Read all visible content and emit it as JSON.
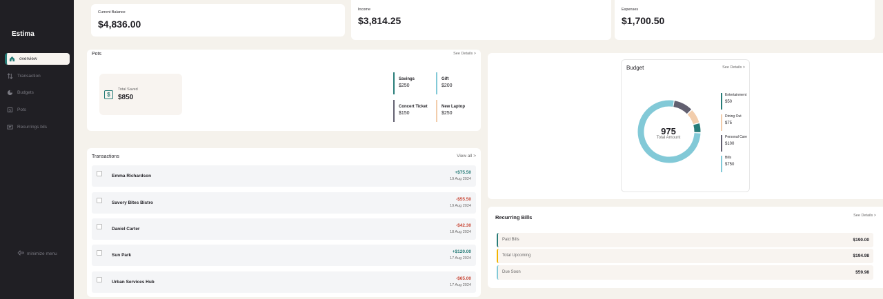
{
  "sidebar": {
    "brand": "Estima",
    "items": [
      {
        "label": "overview",
        "icon": "home-icon"
      },
      {
        "label": "Transaction",
        "icon": "arrows-icon"
      },
      {
        "label": "Budgets",
        "icon": "pie-icon"
      },
      {
        "label": "Pots",
        "icon": "pot-icon"
      },
      {
        "label": "Recurrings bils",
        "icon": "receipt-icon"
      }
    ],
    "minimize_label": "minimize menu"
  },
  "summary": {
    "balance_label": "Current Balance",
    "balance_value": "$4,836.00",
    "income_label": "Income",
    "income_value": "$3,814.25",
    "expenses_label": "Expenses",
    "expenses_value": "$1,700.50"
  },
  "pots": {
    "title": "Pots",
    "see_details": "See Details >",
    "total_label": "Total Saved",
    "total_value": "$850",
    "items": [
      {
        "name": "Savings",
        "amount": "$250",
        "color": "#277c78"
      },
      {
        "name": "Gift",
        "amount": "$200",
        "color": "#82c9d7"
      },
      {
        "name": "Concert Ticket",
        "amount": "$150",
        "color": "#626070"
      },
      {
        "name": "New Laptop",
        "amount": "$250",
        "color": "#f2cdac"
      }
    ]
  },
  "transactions": {
    "title": "Transactions",
    "view_all": "View all >",
    "rows": [
      {
        "name": "Emma Richardson",
        "amount": "+$75.50",
        "date": "19 Aug 2024",
        "positive": true
      },
      {
        "name": "Savory Bites Bistro",
        "amount": "-$55.50",
        "date": "19 Aug 2024",
        "positive": false
      },
      {
        "name": "Daniel Carter",
        "amount": "-$42.30",
        "date": "18 Aug 2024",
        "positive": false
      },
      {
        "name": "Sun Park",
        "amount": "+$120.00",
        "date": "17 Aug 2024",
        "positive": true
      },
      {
        "name": "Urban Services Hub",
        "amount": "-$65.00",
        "date": "17 Aug 2024",
        "positive": false
      }
    ]
  },
  "budget": {
    "title": "Budget",
    "see_details": "See Details >",
    "total": "975",
    "total_label": "Total Amount",
    "categories": [
      {
        "name": "Entertainment",
        "amount": "$50",
        "value": 50,
        "color": "#277c78"
      },
      {
        "name": "Dining Out",
        "amount": "$75",
        "value": 75,
        "color": "#f2cdac"
      },
      {
        "name": "Personal Care",
        "amount": "$100",
        "value": 100,
        "color": "#626070"
      },
      {
        "name": "Bills",
        "amount": "$750",
        "value": 750,
        "color": "#82c9d7"
      }
    ]
  },
  "recurring": {
    "title": "Recurring Bills",
    "see_details": "See Details >",
    "rows": [
      {
        "label": "Paid Bills",
        "value": "$190.00",
        "color": "#277c78"
      },
      {
        "label": "Total Upcoming",
        "value": "$194.98",
        "color": "#f2cdac"
      },
      {
        "label": "Due Soon",
        "value": "$59.98",
        "color": "#82c9d7"
      }
    ]
  }
}
